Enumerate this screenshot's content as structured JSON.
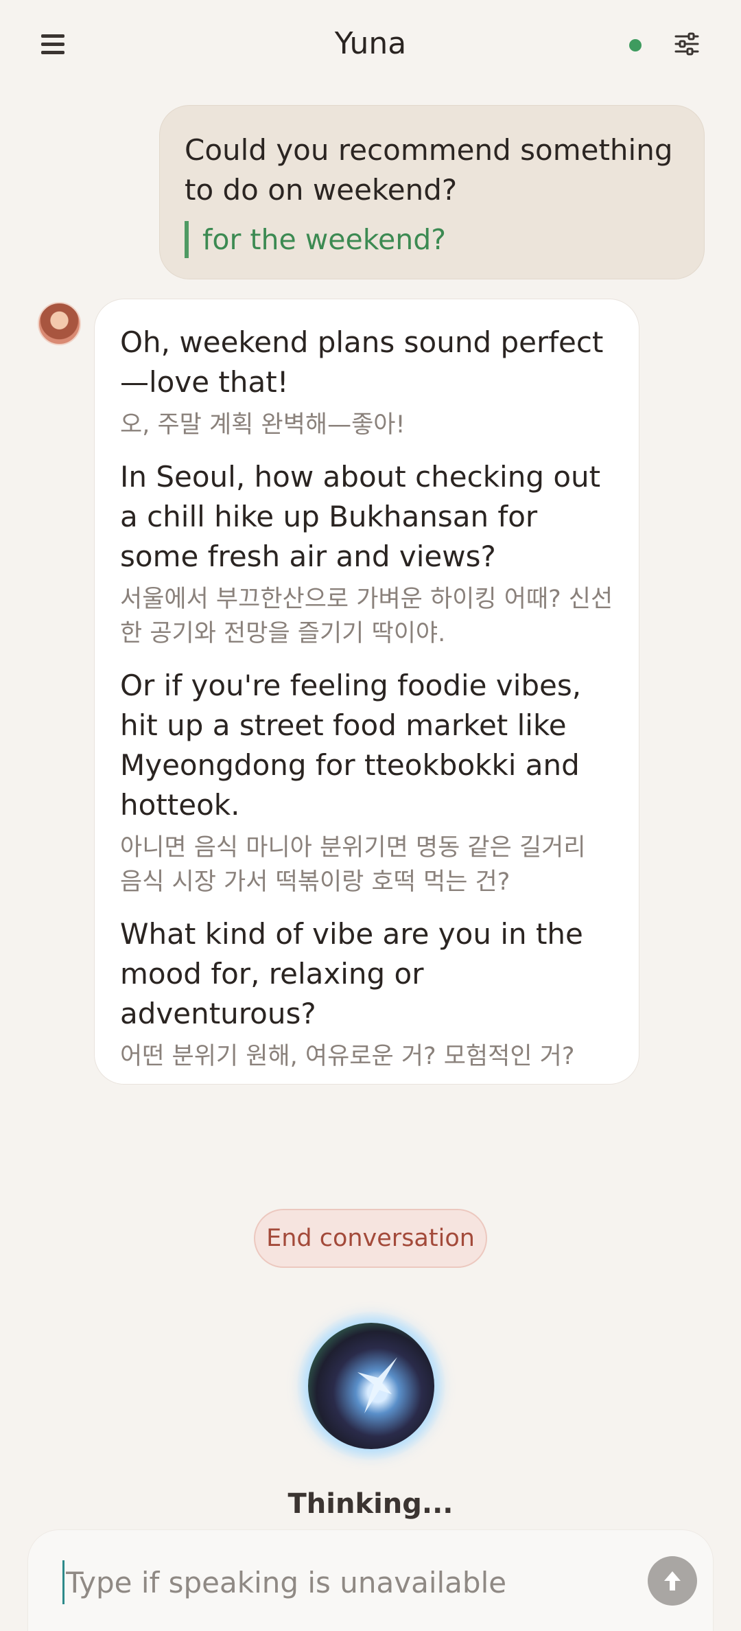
{
  "header": {
    "title": "Yuna",
    "status_color": "#3e9b5f"
  },
  "messages": {
    "user": {
      "text": "Could you recommend something to do on weekend?",
      "correction": "for the weekend?"
    },
    "bot": {
      "paragraphs": [
        {
          "en": "Oh, weekend plans sound perfect—love that!",
          "ko": "오, 주말 계획 완벽해—좋아!"
        },
        {
          "en": "In Seoul, how about checking out a chill hike up Bukhansan for some fresh air and views?",
          "ko": "서울에서 부끄한산으로 가벼운 하이킹 어때? 신선한 공기와 전망을 즐기기 딱이야."
        },
        {
          "en": "Or if you're feeling foodie vibes, hit up a street food market like Myeongdong for tteokbokki and hotteok.",
          "ko": "아니면 음식 마니아 분위기면 명동 같은 길거리 음식 시장 가서 떡볶이랑 호떡 먹는 건?"
        },
        {
          "en": "What kind of vibe are you in the mood for, relaxing or adventurous?",
          "ko": "어떤 분위기 원해, 여유로운 거? 모험적인 거?"
        }
      ]
    }
  },
  "actions": {
    "end_conversation": "End conversation"
  },
  "status": {
    "thinking": "Thinking..."
  },
  "input": {
    "placeholder": "Type if speaking is unavailable",
    "value": ""
  },
  "icons": {
    "menu": "hamburger-icon",
    "settings": "sliders-icon",
    "send": "arrow-up-icon",
    "orb": "voice-orb-icon"
  }
}
